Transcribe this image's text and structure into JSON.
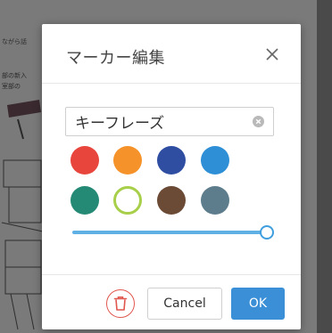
{
  "background": {
    "text_lines": [
      "ながら話",
      "部の新入",
      "室部の"
    ]
  },
  "dialog": {
    "title": "マーカー編集",
    "close_icon": "close-icon",
    "text_field": {
      "value": "キーフレーズ",
      "clear_icon": "clear-icon"
    },
    "colors": {
      "row1": [
        "#e8453c",
        "#f5922a",
        "#2f4ea2",
        "#2e8fd6"
      ],
      "row2": [
        "#248a76",
        "#ffffff",
        "#6b4a36",
        "#5e7d8c"
      ],
      "selected_index": 5,
      "selected_ring": "#a8cf4a"
    },
    "slider": {
      "value_fraction": 1.0,
      "track_color": "#5fb0e4",
      "thumb_border": "#3f9fde"
    },
    "delete_button": {
      "icon": "trash-icon",
      "color": "#e0574d"
    },
    "cancel_label": "Cancel",
    "ok_label": "OK",
    "ok_color": "#3a8fd6"
  }
}
